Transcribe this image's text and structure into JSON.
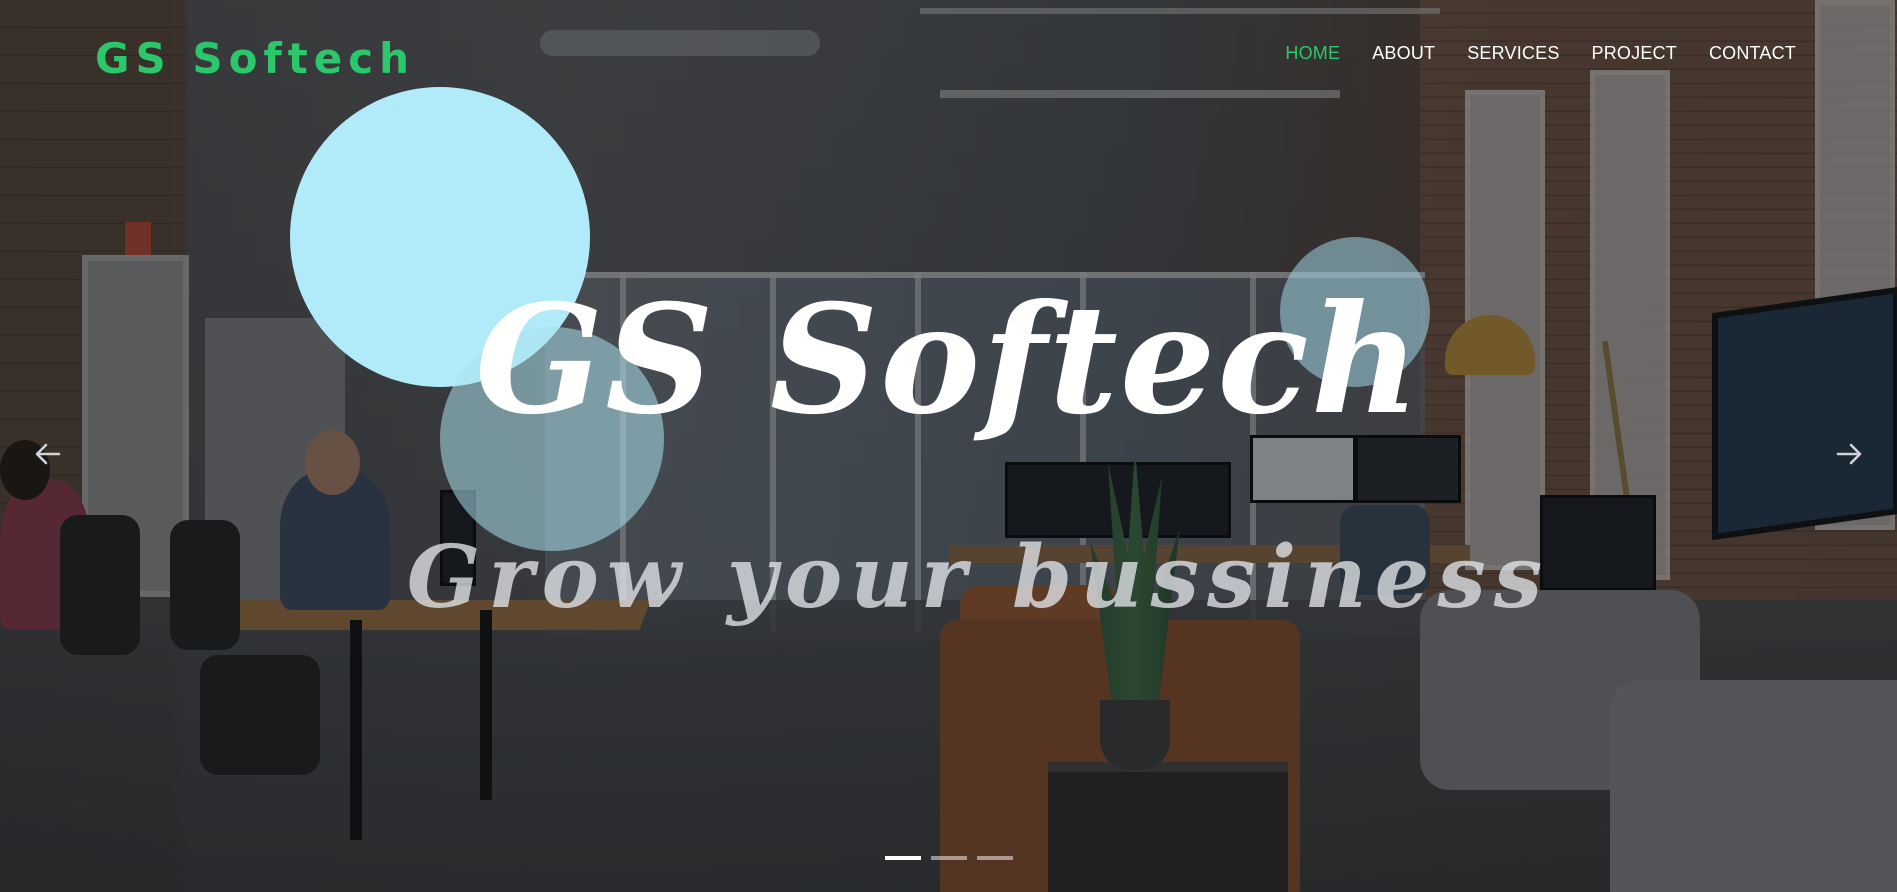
{
  "brand": {
    "name": "GS Softech"
  },
  "nav": {
    "items": [
      {
        "label": "HOME",
        "active": true
      },
      {
        "label": "ABOUT",
        "active": false
      },
      {
        "label": "SERVICES",
        "active": false
      },
      {
        "label": "PROJECT",
        "active": false
      },
      {
        "label": "CONTACT",
        "active": false
      }
    ]
  },
  "hero": {
    "title": "GS Softech",
    "subtitle": "Grow your bussiness"
  },
  "carousel": {
    "prev_icon": "arrow-left-icon",
    "next_icon": "arrow-right-icon",
    "slide_count": 3,
    "active_index": 0
  },
  "colors": {
    "accent": "#2bc76a",
    "nav_text": "#ffffff",
    "bubble": "#b1ebf9"
  }
}
